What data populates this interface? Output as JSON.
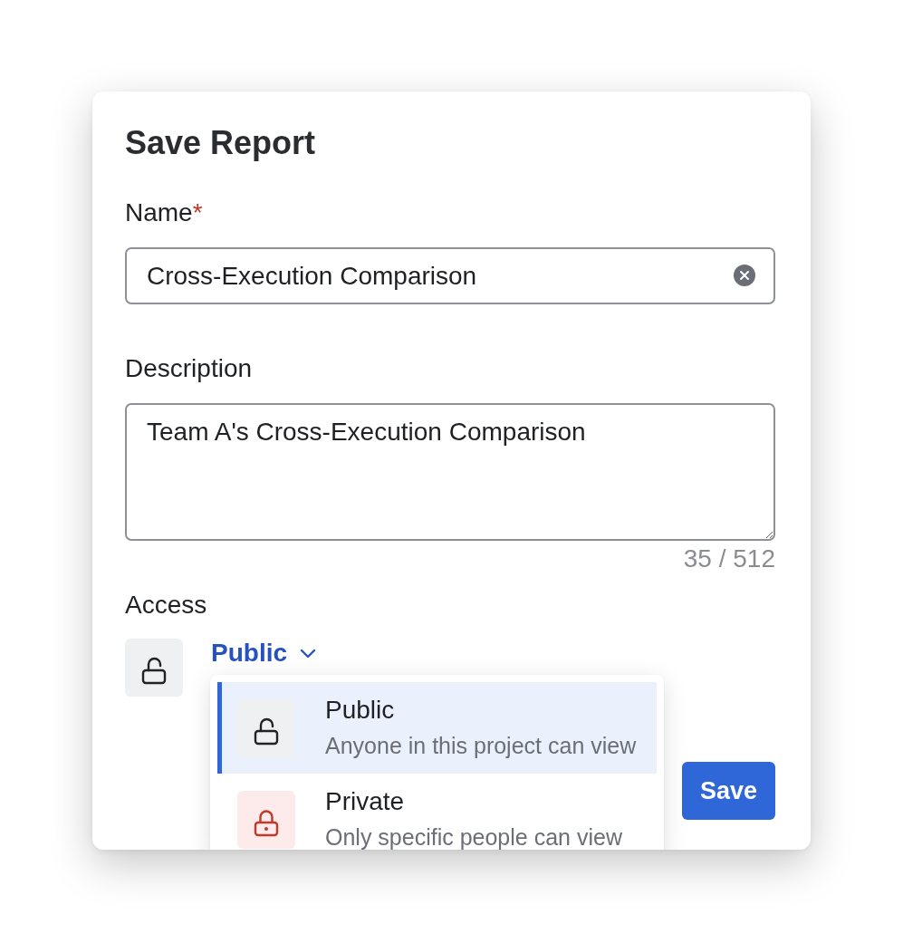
{
  "dialog": {
    "title": "Save Report"
  },
  "fields": [
    {
      "kind": "text",
      "label": "Name",
      "required_mark": "*",
      "value": "Cross-Execution Comparison"
    },
    {
      "kind": "textarea",
      "label": "Description",
      "value": "Team A's Cross-Execution Comparison",
      "counter": "35 / 512"
    }
  ],
  "access": {
    "label": "Access",
    "selector": {
      "label": "Public",
      "kind": "public",
      "expanded": true
    },
    "options": [
      {
        "kind": "public",
        "title": "Public",
        "description": "Anyone in this project can view",
        "selected": true
      },
      {
        "kind": "private",
        "title": "Private",
        "description": "Only specific people can view",
        "selected": false
      }
    ]
  },
  "buttons": [
    {
      "label": "Save"
    }
  ]
}
